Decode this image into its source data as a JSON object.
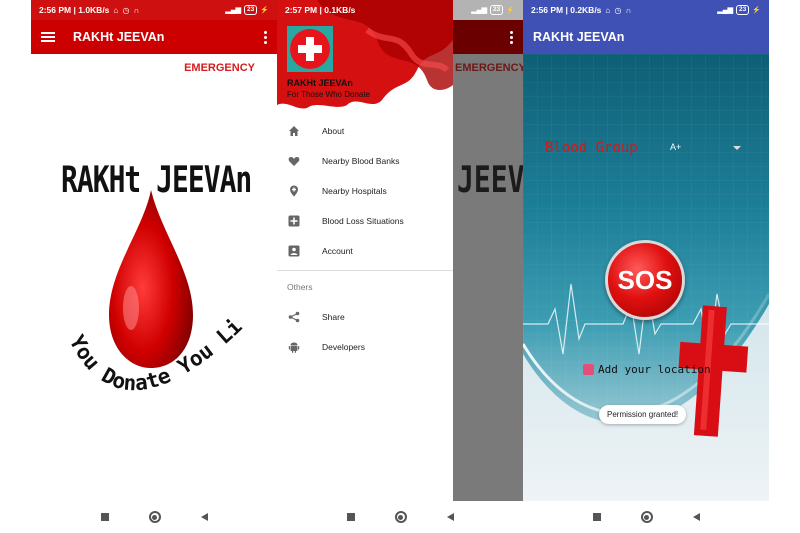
{
  "screens": [
    {
      "status_bar": {
        "time": "2:56 PM | 1.0KB/s",
        "battery": "23"
      },
      "app_bar": {
        "title": "RAKHt JEEVAn"
      },
      "emergency_label": "EMERGENCY",
      "logo": {
        "title": "RAKHt JEEVAn",
        "tagline": "You Donate You Live"
      },
      "colors": {
        "toolbar": "#cc0000",
        "accent": "#d61c1c"
      }
    },
    {
      "status_bar": {
        "time": "2:57 PM | 0.1KB/s",
        "battery": "23"
      },
      "drawer_header": {
        "title": "RAKHt JEEVAn",
        "subtitle": "For Those Who Donate"
      },
      "menu_items": [
        {
          "label": "About",
          "icon": "home-icon"
        },
        {
          "label": "Nearby Blood Banks",
          "icon": "heart-icon"
        },
        {
          "label": "Nearby Hospitals",
          "icon": "location-pin-icon"
        },
        {
          "label": "Blood Loss Situations",
          "icon": "plus-box-icon"
        },
        {
          "label": "Account",
          "icon": "account-box-icon"
        }
      ],
      "section_label": "Others",
      "other_items": [
        {
          "label": "Share",
          "icon": "share-icon"
        },
        {
          "label": "Developers",
          "icon": "android-icon"
        }
      ],
      "background_partial": {
        "emergency": "EMERGENCY",
        "logo": "JEEVAn"
      }
    },
    {
      "status_bar": {
        "time": "2:56 PM | 0.2KB/s",
        "battery": "23"
      },
      "app_bar": {
        "title": "RAKHt JEEVAn"
      },
      "blood_group": {
        "label": "Blood Group",
        "value": "A+"
      },
      "sos_label": "SOS",
      "location_label": "Add your location",
      "toast": "Permission granted!",
      "colors": {
        "toolbar": "#3f51b5"
      }
    }
  ]
}
